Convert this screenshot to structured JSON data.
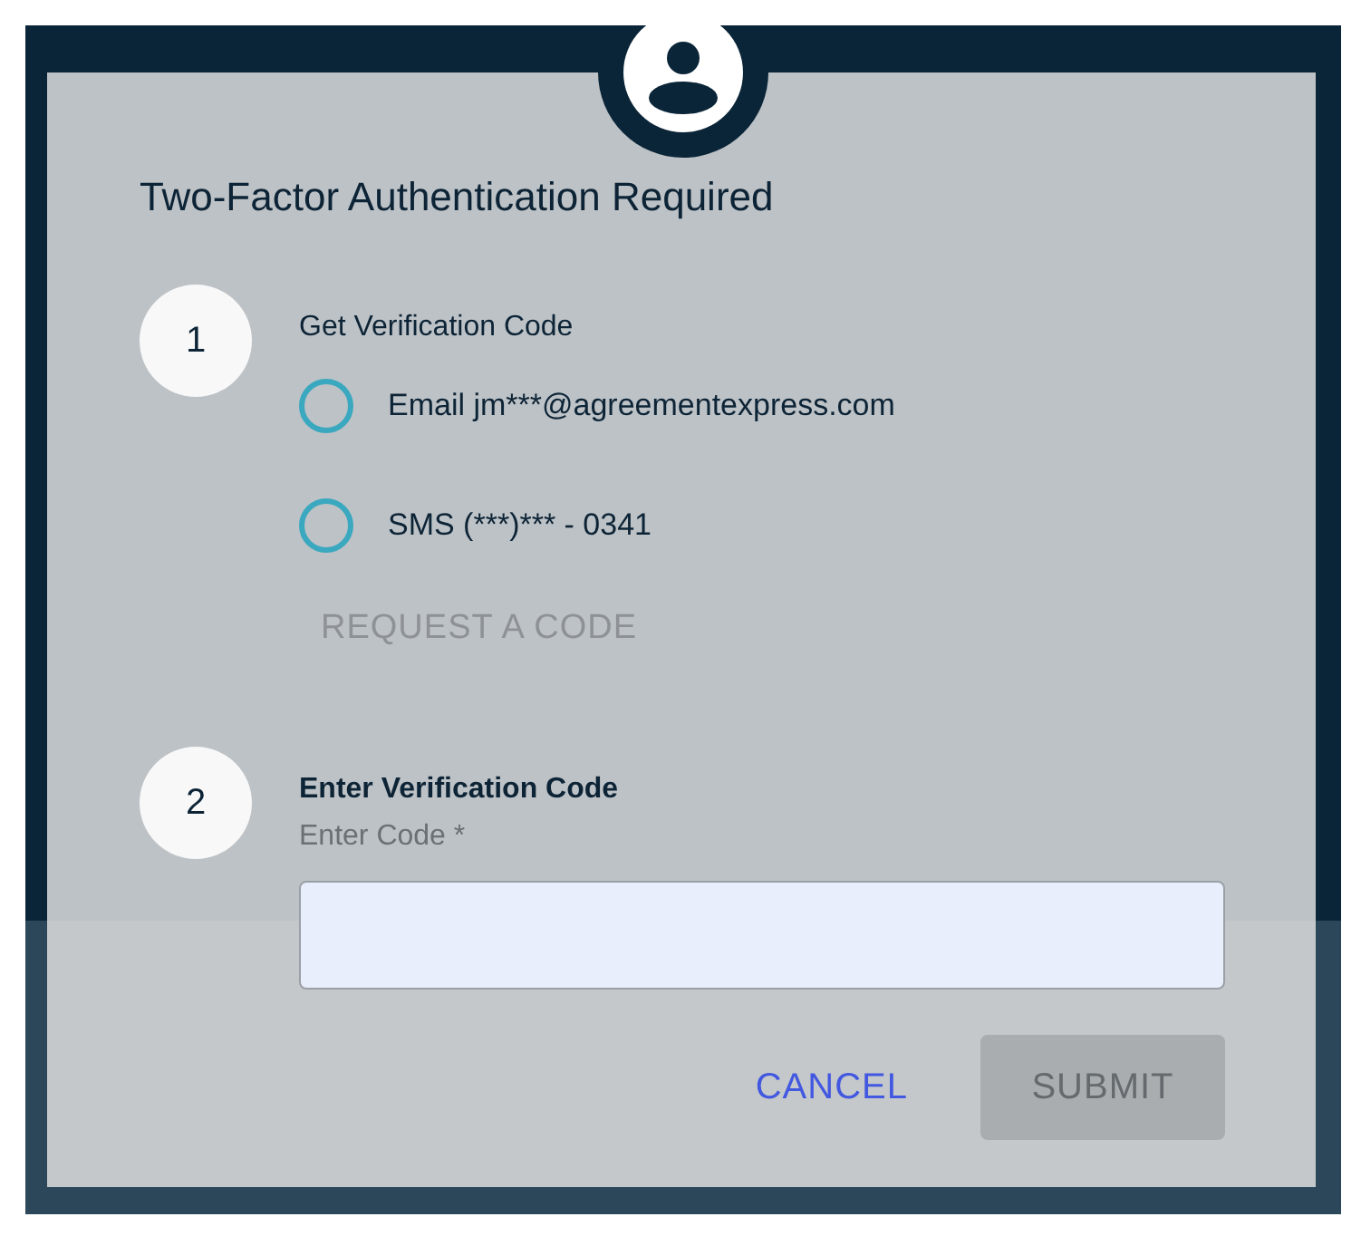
{
  "dialog": {
    "title": "Two-Factor Authentication Required"
  },
  "steps": [
    {
      "number": "1",
      "title": "Get Verification Code",
      "kind": "choose",
      "options": [
        {
          "label": "Email jm***@agreementexpress.com",
          "selected": false
        },
        {
          "label": "SMS (***)*** - 0341",
          "selected": false
        }
      ],
      "action": {
        "label": "REQUEST A CODE",
        "disabled": true
      }
    },
    {
      "number": "2",
      "title": "Enter Verification Code",
      "kind": "enter",
      "field": {
        "label": "Enter Code *"
      }
    }
  ],
  "buttons": [
    {
      "label": "CANCEL",
      "kind": "text",
      "disabled": false
    },
    {
      "label": "SUBMIT",
      "kind": "filled",
      "disabled": true
    }
  ]
}
